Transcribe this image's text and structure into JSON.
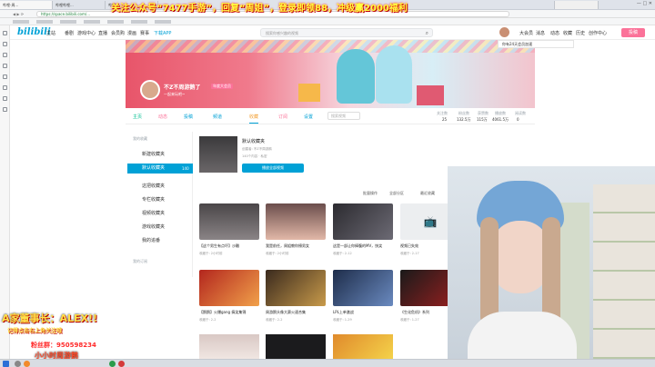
{
  "overlay": {
    "top_banner": "关注公众号“7477手游”，回复“周姐”，登录即领88，冲级赢2000福利",
    "family_head": "A家董事长：ALEX!!",
    "family_sub": "记得点击右上角关注哦",
    "fans_group": "粉丝群：950598234",
    "streamer_name": "小小时周游鹅"
  },
  "browser": {
    "tabs": [
      "哔哩-周...",
      "哔哩哔哩...",
      "哔哩..."
    ],
    "address_hint": "https://space.bilibili.com/...",
    "window_controls": "— □ ✕"
  },
  "nav": {
    "logo": "bilibili",
    "items": [
      "主站",
      "番剧",
      "游戏中心",
      "直播",
      "会员购",
      "漫画",
      "赛事",
      "下载APP"
    ],
    "search_placeholder": "搜索你感兴趣的视频",
    "right_items": [
      "大会员",
      "消息",
      "动态",
      "收藏",
      "历史",
      "创作中心"
    ],
    "upload": "投稿",
    "popup": "你有24天会员加速"
  },
  "profile": {
    "name": "不Z不周游鹅了",
    "badge": "年度大会员",
    "sign": "一起来玩吧~",
    "tabs": [
      "主页",
      "动态",
      "投稿",
      "频道",
      "收藏",
      "订阅",
      "设置"
    ],
    "search_placeholder": "搜索视频",
    "stats_labels": [
      "关注数",
      "粉丝数",
      "获赞数",
      "播放数",
      "阅读数"
    ],
    "stats_values": [
      "25",
      "132.5万",
      "115万",
      "4061.5万",
      "0"
    ]
  },
  "sidebar": {
    "my_fav_header": "我的收藏",
    "items": [
      "新建收藏夹",
      "默认收藏夹",
      "这把收藏夹",
      "专栏收藏夹",
      "视频收藏夹",
      "游戏收藏夹",
      "我的追番"
    ],
    "default_count": "140",
    "subscribe_header": "我的订阅"
  },
  "folder": {
    "title": "默认收藏夹",
    "meta": "创建者: 不Z不周游鹅",
    "count_line": "140个内容 · 私密",
    "play_all": "播放全部视频",
    "sort_options": [
      "批量操作",
      "全部分区",
      "最近收藏"
    ]
  },
  "videos": [
    {
      "title": "【这个男生有点坏】沙雕",
      "meta": "收藏于: 2小时前"
    },
    {
      "title": "我是前任，周姐教你撩男女",
      "meta": "收藏于: 2小时前"
    },
    {
      "title": "这是一部让你捧腹的MV，快笑",
      "meta": "收藏于: 2-12"
    },
    {
      "title": "视频已失效",
      "meta": "收藏于: 2-17"
    },
    {
      "title": "【鹅鹅】火爆gang 搞笑集锦",
      "meta": "收藏于: 2-2"
    },
    {
      "title": "周游鹅头像大赛火速合集",
      "meta": "收藏于: 2-2"
    },
    {
      "title": "LPL上单激战",
      "meta": "收藏于: 1-29"
    },
    {
      "title": "《生化危机》系列",
      "meta": "收藏于: 1-27"
    }
  ],
  "colors": {
    "accent": "#fb7299",
    "link": "#00a1d6",
    "banner_text": "#ffff40"
  }
}
